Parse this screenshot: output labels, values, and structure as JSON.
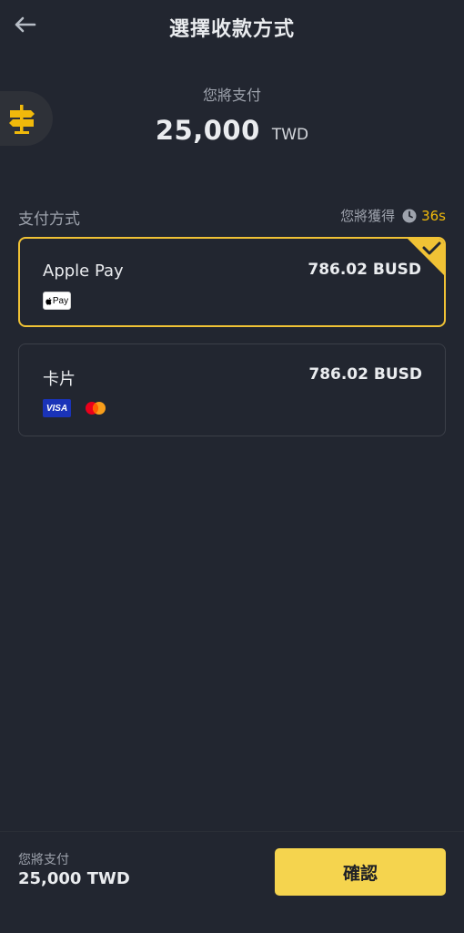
{
  "header": {
    "title": "選擇收款方式",
    "back_icon": "arrow-left-icon"
  },
  "guide": {
    "icon": "signpost-icon",
    "color": "#F0B90B"
  },
  "summary": {
    "pay_label": "您將支付",
    "amount": "25,000",
    "currency": "TWD"
  },
  "section": {
    "title": "支付方式",
    "receive_label": "您將獲得",
    "countdown": "36s"
  },
  "methods": [
    {
      "name": "Apple Pay",
      "amount": "786.02 BUSD",
      "selected": true,
      "badge": "Pay"
    },
    {
      "name": "卡片",
      "amount": "786.02 BUSD",
      "selected": false,
      "badge": "VISA"
    }
  ],
  "footer": {
    "pay_label": "您將支付",
    "total": "25,000 TWD",
    "confirm_label": "確認"
  },
  "colors": {
    "background": "#222630",
    "accent": "#F0B90B",
    "button": "#F5D44E",
    "selected_border": "#F0C235"
  }
}
